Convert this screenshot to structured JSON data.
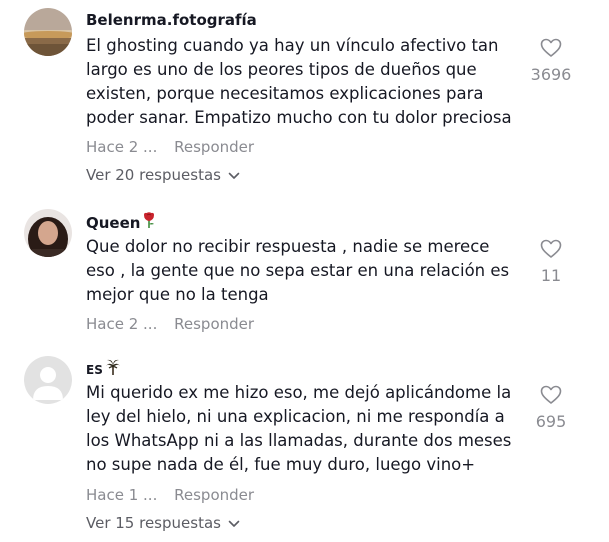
{
  "comments": [
    {
      "username": "Belenrma.fotografía",
      "text": "El ghosting cuando ya hay un vínculo afectivo tan\nlargo es uno de los peores tipos de dueños que\nexisten, porque necesitamos explicaciones para\npoder sanar. Empatizo mucho con tu dolor preciosa",
      "date": "Hace 2 ...",
      "reply_label": "Responder",
      "replies_label": "Ver 20 respuestas",
      "likes": "3696"
    },
    {
      "username": "Queen",
      "text": "Que dolor no recibir respuesta , nadie se merece\neso , la gente que no sepa estar en una relación es\nmejor que no la tenga",
      "date": "Hace 2 ...",
      "reply_label": "Responder",
      "likes": "11"
    },
    {
      "username": "ES",
      "text": "Mi querido ex me hizo eso, me dejó aplicándome la\nley del hielo, ni una explicacion, ni me respondía a\nlos WhatsApp ni a las llamadas, durante dos meses\nno supe nada de él, fue muy duro, luego vino+",
      "date": "Hace 1 ...",
      "reply_label": "Responder",
      "replies_label": "Ver 15 respuestas",
      "likes": "695"
    }
  ],
  "icons": {
    "like": "heart-outline-icon",
    "expand": "chevron-down-icon",
    "queen_tag": "rose-emoji-icon",
    "es_tag": "palm-emoji-icon"
  },
  "colors": {
    "text": "#161823",
    "meta": "#8a8b91",
    "replies": "#5c5d64"
  }
}
